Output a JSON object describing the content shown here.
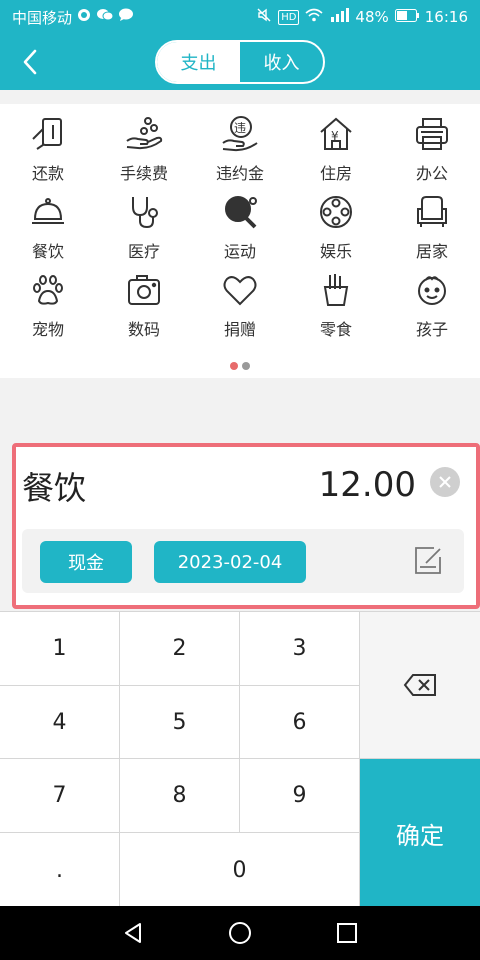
{
  "status_bar": {
    "carrier": "中国移动",
    "battery": "48%",
    "time": "16:16",
    "hd_badge": "HD"
  },
  "header": {
    "back_icon": "chevron-left-icon",
    "tabs": [
      {
        "label": "支出",
        "active": true
      },
      {
        "label": "收入",
        "active": false
      }
    ]
  },
  "categories": [
    {
      "label": "还款",
      "icon": "repayment-card-icon"
    },
    {
      "label": "手续费",
      "icon": "hand-coins-icon"
    },
    {
      "label": "违约金",
      "icon": "penalty-coin-icon",
      "icon_text": "违"
    },
    {
      "label": "住房",
      "icon": "house-yen-icon",
      "icon_text": "¥"
    },
    {
      "label": "办公",
      "icon": "printer-icon"
    },
    {
      "label": "餐饮",
      "icon": "food-cloche-icon"
    },
    {
      "label": "医疗",
      "icon": "stethoscope-icon"
    },
    {
      "label": "运动",
      "icon": "ping-pong-icon"
    },
    {
      "label": "娱乐",
      "icon": "film-reel-icon"
    },
    {
      "label": "居家",
      "icon": "armchair-icon"
    },
    {
      "label": "宠物",
      "icon": "paw-icon"
    },
    {
      "label": "数码",
      "icon": "camera-icon"
    },
    {
      "label": "捐赠",
      "icon": "heart-icon"
    },
    {
      "label": "零食",
      "icon": "fries-icon"
    },
    {
      "label": "孩子",
      "icon": "baby-face-icon"
    }
  ],
  "pager": {
    "pages": 2,
    "current": 1,
    "active_color": "#e76b6b"
  },
  "entry": {
    "category": "餐饮",
    "amount": "12.00",
    "account": "现金",
    "date": "2023-02-04"
  },
  "keypad": {
    "keys": [
      "1",
      "2",
      "3",
      "4",
      "5",
      "6",
      "7",
      "8",
      "9",
      ".",
      "0"
    ],
    "backspace_icon": "backspace-icon",
    "confirm_label": "确定"
  },
  "colors": {
    "accent": "#20b5c6",
    "highlight_border": "#ee6e79"
  }
}
